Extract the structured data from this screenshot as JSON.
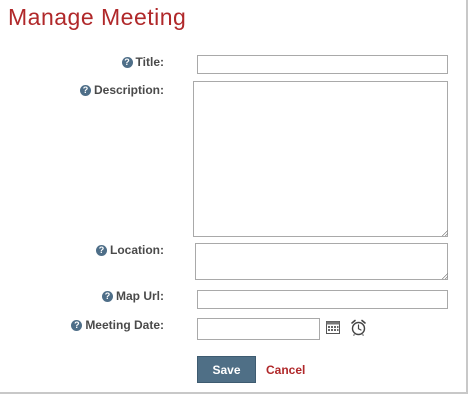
{
  "page": {
    "title": "Manage Meeting"
  },
  "help_glyph": "?",
  "form": {
    "title": {
      "label": "Title:",
      "value": ""
    },
    "description": {
      "label": "Description:",
      "value": ""
    },
    "location": {
      "label": "Location:",
      "value": ""
    },
    "map_url": {
      "label": "Map Url:",
      "value": ""
    },
    "meeting_date": {
      "label": "Meeting Date:",
      "value": ""
    }
  },
  "icons": {
    "calendar": "calendar-icon",
    "clock": "clock-icon",
    "help": "help-icon"
  },
  "actions": {
    "save_label": "Save",
    "cancel_label": "Cancel"
  },
  "colors": {
    "accent": "#b0282a",
    "button": "#4f6f86",
    "label": "#4a4a4a",
    "help_icon": "#4e6e88"
  }
}
